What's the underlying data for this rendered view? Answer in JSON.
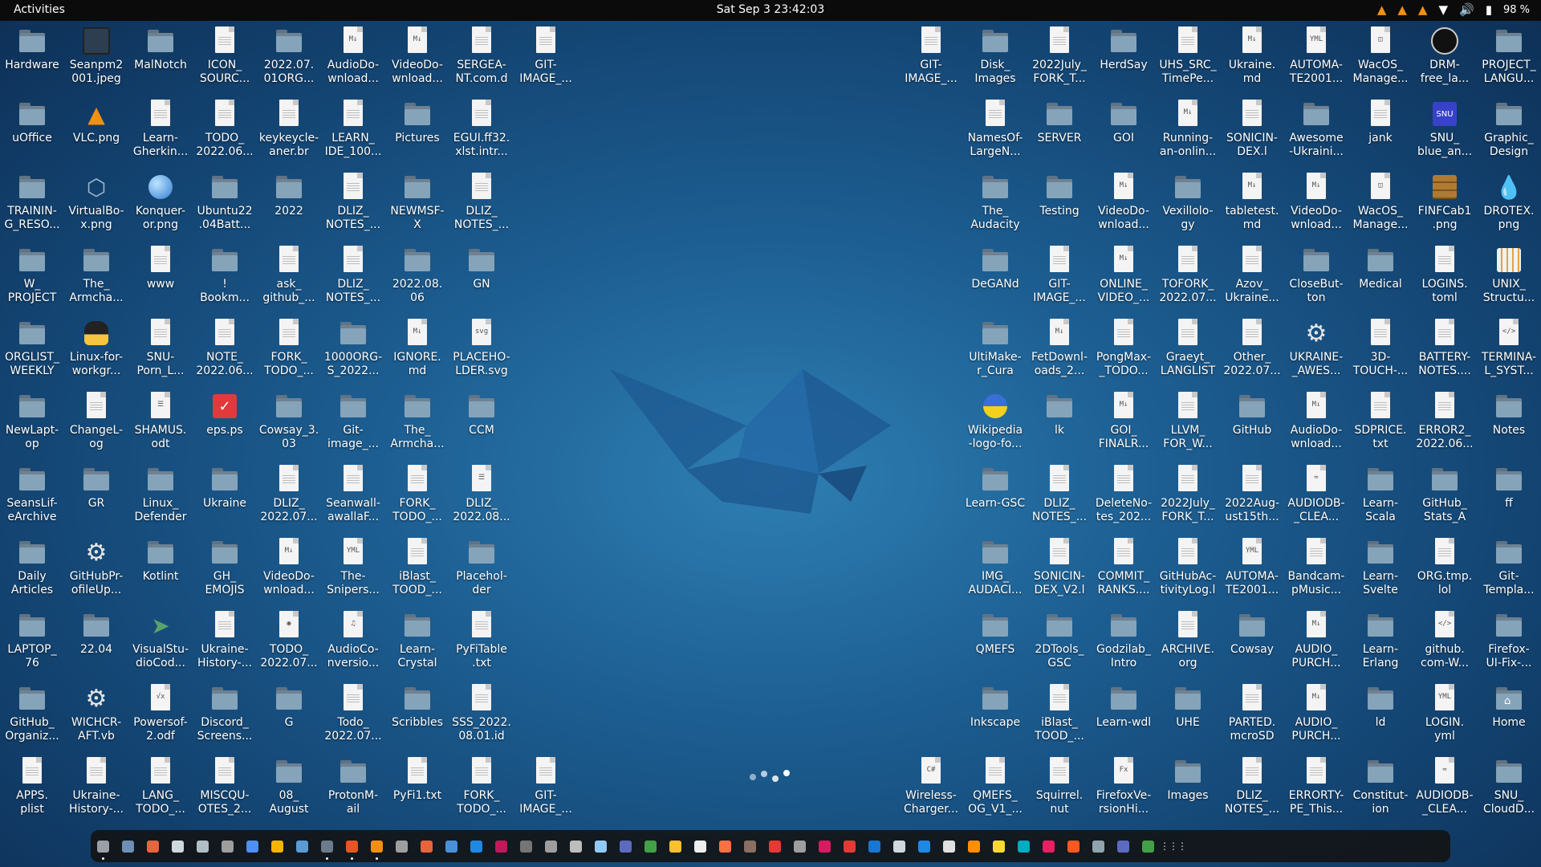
{
  "topbar": {
    "activities": "Activities",
    "clock": "Sat Sep 3  23:42:03",
    "battery_percent": "98 %"
  },
  "desktop": {
    "columns_left": [
      [
        {
          "label": "Hardware",
          "icon": "folder"
        },
        {
          "label": "uOffice",
          "icon": "folder"
        },
        {
          "label": "TRAININ-\nG_RESO...",
          "icon": "folder"
        },
        {
          "label": "W_\nPROJECT",
          "icon": "folder"
        },
        {
          "label": "ORGLIST_\nWEEKLY",
          "icon": "folder"
        },
        {
          "label": "NewLapt-\nop",
          "icon": "folder"
        },
        {
          "label": "SeansLif-\neArchive",
          "icon": "folder"
        },
        {
          "label": "Daily\nArticles",
          "icon": "folder"
        },
        {
          "label": "LAPTOP_\n76",
          "icon": "folder"
        },
        {
          "label": "GitHub_\nOrganiz...",
          "icon": "folder"
        },
        {
          "label": "APPS.\nplist",
          "icon": "document"
        }
      ],
      [
        {
          "label": "Seanpm2\n001.jpeg",
          "icon": "image"
        },
        {
          "label": "VLC.png",
          "icon": "vlc"
        },
        {
          "label": "VirtualBo-\nx.png",
          "icon": "virtualbox"
        },
        {
          "label": "The_\nArmcha...",
          "icon": "folder"
        },
        {
          "label": "Linux-for-\nworkgr...",
          "icon": "tux"
        },
        {
          "label": "ChangeL-\nog",
          "icon": "document"
        },
        {
          "label": "GR",
          "icon": "folder"
        },
        {
          "label": "GitHubPr-\nofileUp...",
          "icon": "gear"
        },
        {
          "label": "22.04",
          "icon": "folder"
        },
        {
          "label": "WICHCR-\nAFT.vb",
          "icon": "gear"
        },
        {
          "label": "Ukraine-\nHistory-...",
          "icon": "document"
        }
      ],
      [
        {
          "label": "MalNotch",
          "icon": "folder"
        },
        {
          "label": "Learn-\nGherkin...",
          "icon": "document"
        },
        {
          "label": "Konquer-\nor.png",
          "icon": "globe"
        },
        {
          "label": "www",
          "icon": "document"
        },
        {
          "label": "SNU-\nPorn_L...",
          "icon": "document"
        },
        {
          "label": "SHAMUS.\nodt",
          "icon": "writer"
        },
        {
          "label": "Linux_\nDefender",
          "icon": "folder"
        },
        {
          "label": "Kotlint",
          "icon": "folder"
        },
        {
          "label": "VisualStu-\ndioCod...",
          "icon": "vscode"
        },
        {
          "label": "Powersof-\n2.odf",
          "icon": "formula"
        },
        {
          "label": "LANG_\nTODO_...",
          "icon": "document"
        }
      ],
      [
        {
          "label": "ICON_\nSOURC...",
          "icon": "document"
        },
        {
          "label": "TODO_\n2022.06...",
          "icon": "document"
        },
        {
          "label": "Ubuntu22\n.04Batt...",
          "icon": "folder"
        },
        {
          "label": "!\nBookm...",
          "icon": "folder"
        },
        {
          "label": "NOTE_\n2022.06...",
          "icon": "document"
        },
        {
          "label": "eps.ps",
          "icon": "ps"
        },
        {
          "label": "Ukraine",
          "icon": "folder"
        },
        {
          "label": "GH_\nEMOJIS",
          "icon": "folder"
        },
        {
          "label": "Ukraine-\nHistory-...",
          "icon": "document"
        },
        {
          "label": "Discord_\nScreens...",
          "icon": "folder"
        },
        {
          "label": "MISCQU-\nOTES_2...",
          "icon": "document"
        }
      ],
      [
        {
          "label": "2022.07.\n01ORG...",
          "icon": "folder"
        },
        {
          "label": "keykeycle-\naner.br",
          "icon": "document"
        },
        {
          "label": "2022",
          "icon": "folder"
        },
        {
          "label": "ask_\ngithub_...",
          "icon": "document"
        },
        {
          "label": "FORK_\nTODO_...",
          "icon": "document"
        },
        {
          "label": "Cowsay_3.\n03",
          "icon": "folder"
        },
        {
          "label": "DLIZ_\n2022.07...",
          "icon": "document"
        },
        {
          "label": "VideoDo-\nwnload...",
          "icon": "md"
        },
        {
          "label": "TODO_\n2022.07...",
          "icon": "disc"
        },
        {
          "label": "G",
          "icon": "folder"
        },
        {
          "label": "08_\nAugust",
          "icon": "folder"
        }
      ],
      [
        {
          "label": "AudioDo-\nwnload...",
          "icon": "md"
        },
        {
          "label": "LEARN_\nIDE_100...",
          "icon": "document"
        },
        {
          "label": "DLIZ_\nNOTES_...",
          "icon": "document"
        },
        {
          "label": "DLIZ_\nNOTES_...",
          "icon": "document"
        },
        {
          "label": "1000ORG-\nS_2022...",
          "icon": "folder"
        },
        {
          "label": "Git-\nimage_...",
          "icon": "folder"
        },
        {
          "label": "Seanwall-\nawallaF...",
          "icon": "document"
        },
        {
          "label": "The-\nSnipers...",
          "icon": "yaml"
        },
        {
          "label": "AudioCo-\nnversio...",
          "icon": "music"
        },
        {
          "label": "Todo_\n2022.07...",
          "icon": "document"
        },
        {
          "label": "ProtonM-\nail",
          "icon": "folder"
        }
      ],
      [
        {
          "label": "VideoDo-\nwnload...",
          "icon": "md"
        },
        {
          "label": "Pictures",
          "icon": "folder"
        },
        {
          "label": "NEWMSF-\nX",
          "icon": "folder"
        },
        {
          "label": "2022.08.\n06",
          "icon": "folder"
        },
        {
          "label": "IGNORE.\nmd",
          "icon": "md"
        },
        {
          "label": "The_\nArmcha...",
          "icon": "folder"
        },
        {
          "label": "FORK_\nTODO_...",
          "icon": "document"
        },
        {
          "label": "iBlast_\nTOOD_...",
          "icon": "document"
        },
        {
          "label": "Learn-\nCrystal",
          "icon": "folder"
        },
        {
          "label": "Scribbles",
          "icon": "folder"
        },
        {
          "label": "PyFi1.txt",
          "icon": "document"
        }
      ],
      [
        {
          "label": "SERGEA-\nNT.com.d",
          "icon": "document"
        },
        {
          "label": "EGUI.ff32.\nxlst.intr...",
          "icon": "document"
        },
        {
          "label": "DLIZ_\nNOTES_...",
          "icon": "document"
        },
        {
          "label": "GN",
          "icon": "folder"
        },
        {
          "label": "PLACEHO-\nLDER.svg",
          "icon": "svg"
        },
        {
          "label": "CCM",
          "icon": "folder"
        },
        {
          "label": "DLIZ_\n2022.08...",
          "icon": "writer"
        },
        {
          "label": "Placehol-\nder",
          "icon": "folder"
        },
        {
          "label": "PyFiTable\n.txt",
          "icon": "document"
        },
        {
          "label": "SSS_2022.\n08.01.id",
          "icon": "document"
        },
        {
          "label": "FORK_\nTODO_...",
          "icon": "document"
        }
      ],
      [
        {
          "label": "GIT-\nIMAGE_...",
          "icon": "document"
        },
        null,
        null,
        null,
        null,
        null,
        null,
        null,
        null,
        null,
        {
          "label": "GIT-\nIMAGE_...",
          "icon": "document"
        }
      ]
    ],
    "columns_right": [
      [
        {
          "label": "GIT-\nIMAGE_...",
          "icon": "document"
        },
        null,
        null,
        null,
        null,
        null,
        null,
        null,
        null,
        null,
        {
          "label": "Wireless-\nCharger...",
          "icon": "csharp"
        }
      ],
      [
        {
          "label": "Disk_\nImages",
          "icon": "folder"
        },
        {
          "label": "NamesOf-\nLargeN...",
          "icon": "document"
        },
        {
          "label": "The_\nAudacity",
          "icon": "folder"
        },
        {
          "label": "DeGANd",
          "icon": "folder"
        },
        {
          "label": "UltiMake-\nr_Cura",
          "icon": "folder"
        },
        {
          "label": "Wikipedia\n-logo-fo...",
          "icon": "wiki"
        },
        {
          "label": "Learn-GSC",
          "icon": "folder"
        },
        {
          "label": "IMG_\nAUDACI...",
          "icon": "folder"
        },
        {
          "label": "QMEFS",
          "icon": "folder"
        },
        {
          "label": "Inkscape",
          "icon": "folder"
        },
        {
          "label": "QMEFS_\nOG_V1_...",
          "icon": "document"
        }
      ],
      [
        {
          "label": "2022July_\nFORK_T...",
          "icon": "document"
        },
        {
          "label": "SERVER",
          "icon": "folder"
        },
        {
          "label": "Testing",
          "icon": "folder"
        },
        {
          "label": "GIT-\nIMAGE_...",
          "icon": "document"
        },
        {
          "label": "FetDownl-\noads_2...",
          "icon": "md"
        },
        {
          "label": "lk",
          "icon": "folder"
        },
        {
          "label": "DLIZ_\nNOTES_...",
          "icon": "document"
        },
        {
          "label": "SONICIN-\nDEX_V2.l",
          "icon": "document"
        },
        {
          "label": "2DTools_\nGSC",
          "icon": "folder"
        },
        {
          "label": "iBlast_\nTOOD_...",
          "icon": "document"
        },
        {
          "label": "Squirrel.\nnut",
          "icon": "document"
        }
      ],
      [
        {
          "label": "HerdSay",
          "icon": "folder"
        },
        {
          "label": "GOI",
          "icon": "folder"
        },
        {
          "label": "VideoDo-\nwnload...",
          "icon": "md"
        },
        {
          "label": "ONLINE_\nVIDEO_...",
          "icon": "md"
        },
        {
          "label": "PongMax-\n_TODO...",
          "icon": "document"
        },
        {
          "label": "GOI_\nFINALR...",
          "icon": "md"
        },
        {
          "label": "DeleteNo-\ntes_202...",
          "icon": "document"
        },
        {
          "label": "COMMIT_\nRANKS....",
          "icon": "document"
        },
        {
          "label": "Godzilab_\nIntro",
          "icon": "folder"
        },
        {
          "label": "Learn-wdl",
          "icon": "folder"
        },
        {
          "label": "FirefoxVe-\nrsionHi...",
          "icon": "fx"
        }
      ],
      [
        {
          "label": "UHS_SRC_\nTimePe...",
          "icon": "document"
        },
        {
          "label": "Running-\nan-onlin...",
          "icon": "md"
        },
        {
          "label": "Vexillolo-\ngy",
          "icon": "folder"
        },
        {
          "label": "TOFORK_\n2022.07...",
          "icon": "document"
        },
        {
          "label": "Graeyt_\nLANGLIST",
          "icon": "document"
        },
        {
          "label": "LLVM_\nFOR_W...",
          "icon": "document"
        },
        {
          "label": "2022July_\nFORK_T...",
          "icon": "document"
        },
        {
          "label": "GitHubAc-\ntivityLog.l",
          "icon": "document"
        },
        {
          "label": "ARCHIVE.\norg",
          "icon": "document"
        },
        {
          "label": "UHE",
          "icon": "folder"
        },
        {
          "label": "Images",
          "icon": "folder"
        }
      ],
      [
        {
          "label": "Ukraine.\nmd",
          "icon": "md"
        },
        {
          "label": "SONICIN-\nDEX.l",
          "icon": "document"
        },
        {
          "label": "tabletest.\nmd",
          "icon": "md"
        },
        {
          "label": "Azov_\nUkraine...",
          "icon": "document"
        },
        {
          "label": "Other_\n2022.07...",
          "icon": "document"
        },
        {
          "label": "GitHub",
          "icon": "folder"
        },
        {
          "label": "2022Aug-\nust15th...",
          "icon": "document"
        },
        {
          "label": "AUTOMA-\nTE2001...",
          "icon": "yaml"
        },
        {
          "label": "Cowsay",
          "icon": "folder"
        },
        {
          "label": "PARTED.\nmcroSD",
          "icon": "document"
        },
        {
          "label": "DLIZ_\nNOTES_...",
          "icon": "document"
        }
      ],
      [
        {
          "label": "AUTOMA-\nTE2001...",
          "icon": "yaml"
        },
        {
          "label": "Awesome\n-Ukraini...",
          "icon": "folder"
        },
        {
          "label": "VideoDo-\nwnload...",
          "icon": "md"
        },
        {
          "label": "CloseBut-\nton",
          "icon": "folder"
        },
        {
          "label": "UKRAINE-\n_AWES...",
          "icon": "gear"
        },
        {
          "label": "AudioDo-\nwnload...",
          "icon": "md"
        },
        {
          "label": "AUDIODB-\n_CLEA...",
          "icon": "audiodb"
        },
        {
          "label": "Bandcam-\npMusic...",
          "icon": "document"
        },
        {
          "label": "AUDIO_\nPURCH...",
          "icon": "md"
        },
        {
          "label": "AUDIO_\nPURCH...",
          "icon": "md"
        },
        {
          "label": "ERRORTY-\nPE_This...",
          "icon": "document"
        }
      ],
      [
        {
          "label": "WacOS_\nManage...",
          "icon": "db"
        },
        {
          "label": "jank",
          "icon": "document"
        },
        {
          "label": "WacOS_\nManage...",
          "icon": "db"
        },
        {
          "label": "Medical",
          "icon": "folder"
        },
        {
          "label": "3D-\nTOUCH-...",
          "icon": "document"
        },
        {
          "label": "SDPRICE.\ntxt",
          "icon": "document"
        },
        {
          "label": "Learn-\nScala",
          "icon": "folder"
        },
        {
          "label": "Learn-\nSvelte",
          "icon": "folder"
        },
        {
          "label": "Learn-\nErlang",
          "icon": "folder"
        },
        {
          "label": "ld",
          "icon": "folder"
        },
        {
          "label": "Constitut-\nion",
          "icon": "folder"
        }
      ],
      [
        {
          "label": "DRM-\nfree_la...",
          "icon": "drm"
        },
        {
          "label": "SNU_\nblue_an...",
          "icon": "snu"
        },
        {
          "label": "FINFCab1\n.png",
          "icon": "cabinet"
        },
        {
          "label": "LOGINS.\ntoml",
          "icon": "document"
        },
        {
          "label": "BATTERY-\nNOTES....",
          "icon": "document"
        },
        {
          "label": "ERROR2_\n2022.06...",
          "icon": "document"
        },
        {
          "label": "GitHub_\nStats_A",
          "icon": "folder"
        },
        {
          "label": "ORG.tmp.\nlol",
          "icon": "document"
        },
        {
          "label": "github.\ncom-W...",
          "icon": "code"
        },
        {
          "label": "LOGIN.\nyml",
          "icon": "yaml"
        },
        {
          "label": "AUDIODB-\n_CLEA...",
          "icon": "audiodb"
        }
      ],
      [
        {
          "label": "PROJECT_\nLANGU...",
          "icon": "folder"
        },
        {
          "label": "Graphic_\nDesign",
          "icon": "folder"
        },
        {
          "label": "DROTEX.\npng",
          "icon": "drop"
        },
        {
          "label": "UNIX_\nStructu...",
          "icon": "diagram"
        },
        {
          "label": "TERMINA-\nL_SYST...",
          "icon": "code"
        },
        {
          "label": "Notes",
          "icon": "folder"
        },
        {
          "label": "ff",
          "icon": "folder"
        },
        {
          "label": "Git-\nTempla...",
          "icon": "folder"
        },
        {
          "label": "Firefox-\nUI-Fix-...",
          "icon": "folder"
        },
        {
          "label": "Home",
          "icon": "home"
        },
        {
          "label": "SNU_\nCloudD...",
          "icon": "folder"
        }
      ]
    ]
  },
  "dock": {
    "item_colors": [
      "#9aa0a6",
      "#6d8fb5",
      "#e8643c",
      "#cfd8dc",
      "#b0bec5",
      "#9e9e9e",
      "#4f8ff7",
      "#f4b400",
      "#5b9bd5",
      "#6b7b8b",
      "#e25822",
      "#f29111",
      "#9e9e9e",
      "#e8643c",
      "#4a90d9",
      "#1e88e5",
      "#c2185b",
      "#757575",
      "#9e9e9e",
      "#bdbdbd",
      "#90caf9",
      "#5c6bc0",
      "#43a047",
      "#fbc02d",
      "#eeeeee",
      "#ff7043",
      "#8d6e63",
      "#e53935",
      "#9e9e9e",
      "#d81b60",
      "#e53935",
      "#1976d2",
      "#cfd8dc",
      "#1e88e5",
      "#e0e0e0",
      "#ff8f00",
      "#fdd835",
      "#00acc1",
      "#e91e63",
      "#ff5722",
      "#90a4ae",
      "#5c6bc0",
      "#43a047"
    ],
    "apps_grid_icon": "apps-grid-icon"
  }
}
